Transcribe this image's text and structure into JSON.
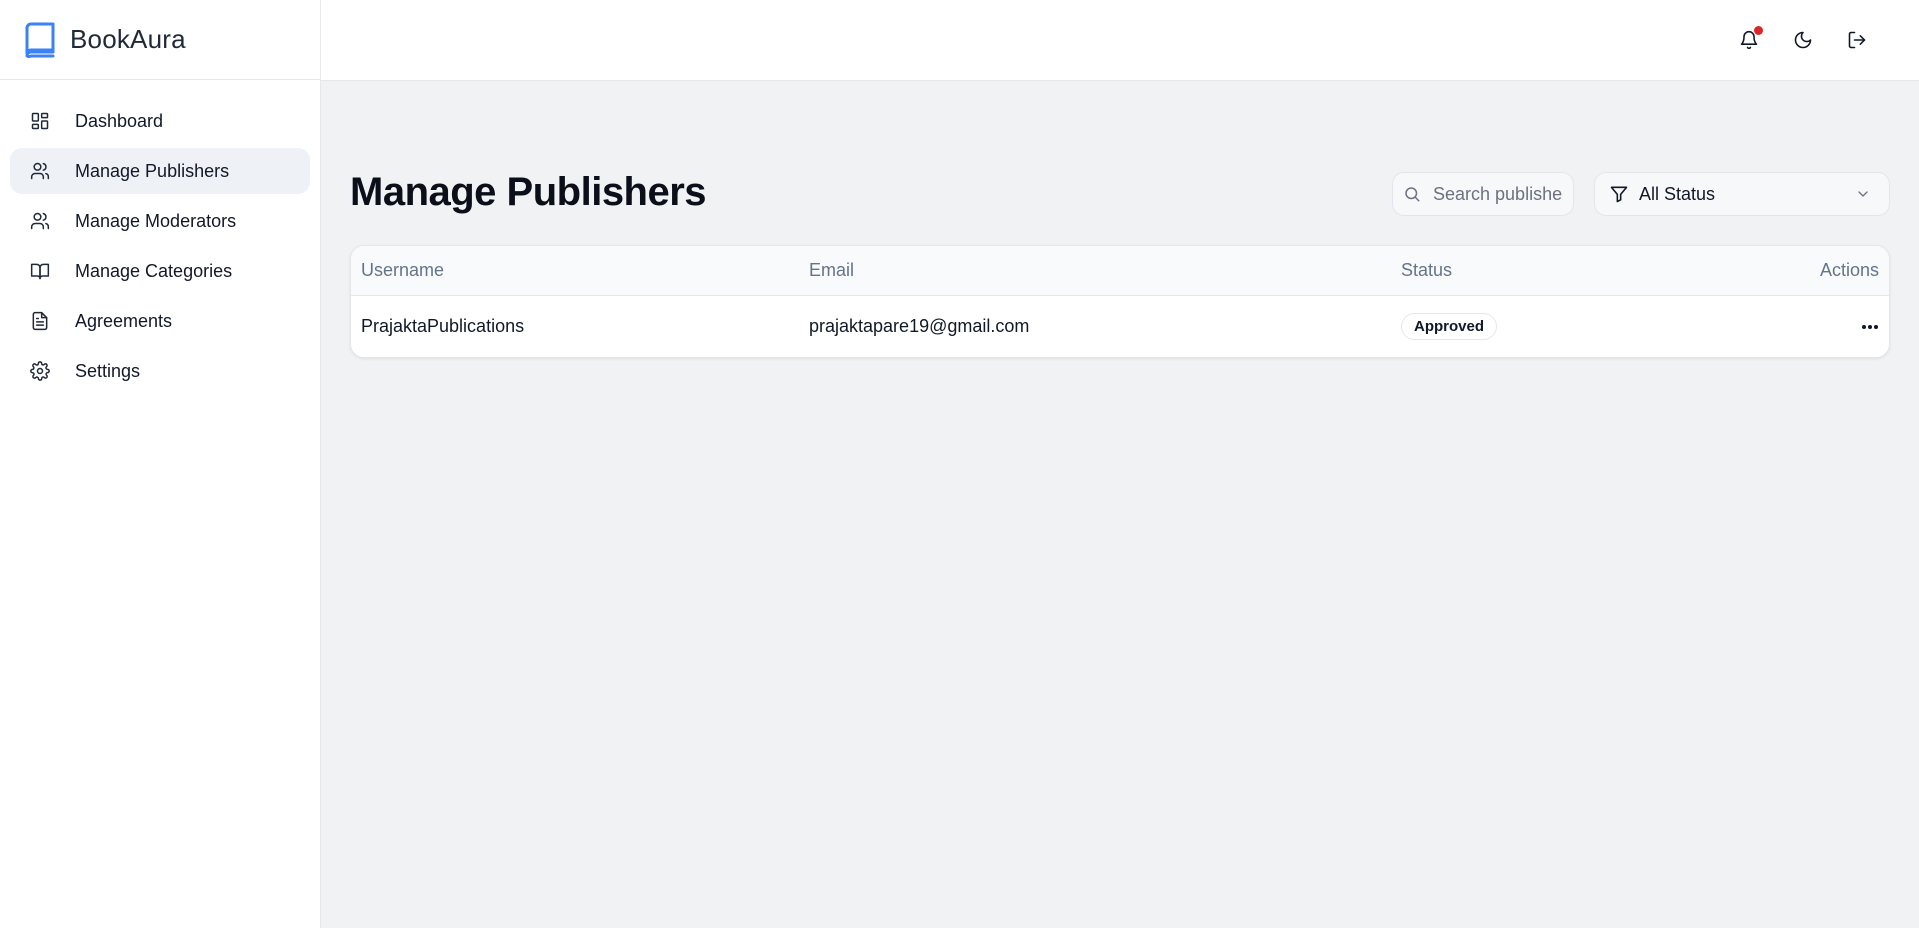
{
  "brand": {
    "name": "BookAura",
    "icon": "book-icon",
    "accent": "#3b82f6"
  },
  "sidebar": {
    "items": [
      {
        "label": "Dashboard",
        "icon": "dashboard-icon",
        "active": false
      },
      {
        "label": "Manage Publishers",
        "icon": "users-icon",
        "active": true
      },
      {
        "label": "Manage Moderators",
        "icon": "users-icon",
        "active": false
      },
      {
        "label": "Manage Categories",
        "icon": "book-open-icon",
        "active": false
      },
      {
        "label": "Agreements",
        "icon": "document-icon",
        "active": false
      },
      {
        "label": "Settings",
        "icon": "gear-icon",
        "active": false
      }
    ]
  },
  "topbar": {
    "icons": [
      "bell-icon",
      "moon-icon",
      "logout-icon"
    ],
    "notification_dot_color": "#dc2626"
  },
  "main": {
    "title": "Manage Publishers",
    "search": {
      "placeholder": "Search publishers...",
      "value": ""
    },
    "status_filter": {
      "selected": "All Status"
    },
    "table": {
      "headers": {
        "username": "Username",
        "email": "Email",
        "status": "Status",
        "actions": "Actions"
      },
      "rows": [
        {
          "username": "PrajaktaPublications",
          "email": "prajaktapare19@gmail.com",
          "status": "Approved"
        }
      ]
    }
  }
}
